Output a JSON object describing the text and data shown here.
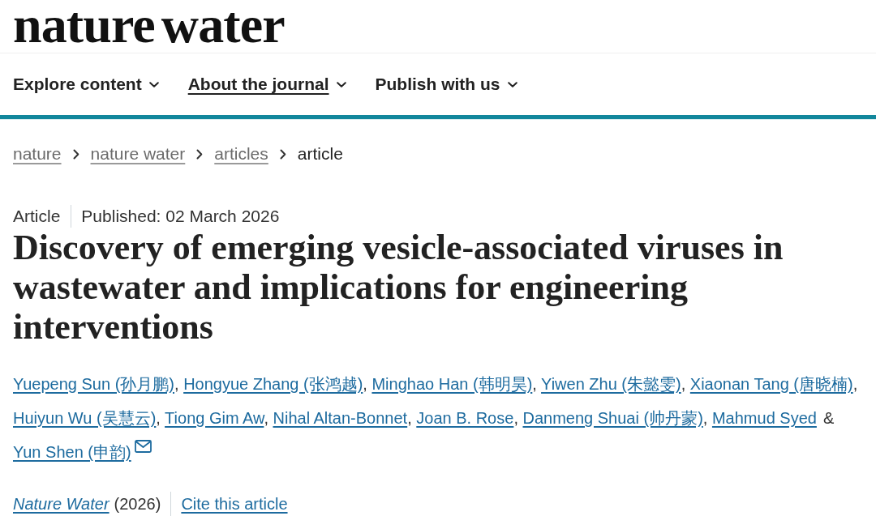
{
  "header": {
    "logo": "nature water"
  },
  "nav": {
    "items": [
      {
        "label": "Explore content",
        "selected": false
      },
      {
        "label": "About the journal",
        "selected": true
      },
      {
        "label": "Publish with us",
        "selected": false
      }
    ]
  },
  "breadcrumb": {
    "items": [
      {
        "label": "nature",
        "kind": "link"
      },
      {
        "label": "nature water",
        "kind": "link"
      },
      {
        "label": "articles",
        "kind": "link"
      },
      {
        "label": "article",
        "kind": "current"
      }
    ]
  },
  "article": {
    "type": "Article",
    "published": "Published: 02 March 2026",
    "title": "Discovery of emerging vesicle-associated viruses in wastewater and implications for engineering interventions",
    "authors": [
      {
        "name": "Yuepeng Sun (孙月鹏)",
        "separator": ",",
        "corresponding": false
      },
      {
        "name": "Hongyue Zhang (张鸿越)",
        "separator": ",",
        "corresponding": false
      },
      {
        "name": "Minghao Han (韩明昊)",
        "separator": ",",
        "corresponding": false
      },
      {
        "name": "Yiwen Zhu (朱懿雯)",
        "separator": ",",
        "corresponding": false
      },
      {
        "name": "Xiaonan Tang (唐晓楠)",
        "separator": ",",
        "corresponding": false
      },
      {
        "name": "Huiyun Wu (吴慧云)",
        "separator": ",",
        "corresponding": false
      },
      {
        "name": "Tiong Gim Aw",
        "separator": ",",
        "corresponding": false
      },
      {
        "name": "Nihal Altan-Bonnet",
        "separator": ",",
        "corresponding": false
      },
      {
        "name": "Joan B. Rose",
        "separator": ",",
        "corresponding": false
      },
      {
        "name": "Danmeng Shuai (帅丹蒙)",
        "separator": ",",
        "corresponding": false
      },
      {
        "name": "Mahmud Syed",
        "separator": "&",
        "corresponding": false
      },
      {
        "name": "Yun Shen (申韵)",
        "corresponding": true
      }
    ],
    "citation": {
      "journal": "Nature Water",
      "year": "(2026)",
      "cite_link": "Cite this article"
    }
  }
}
